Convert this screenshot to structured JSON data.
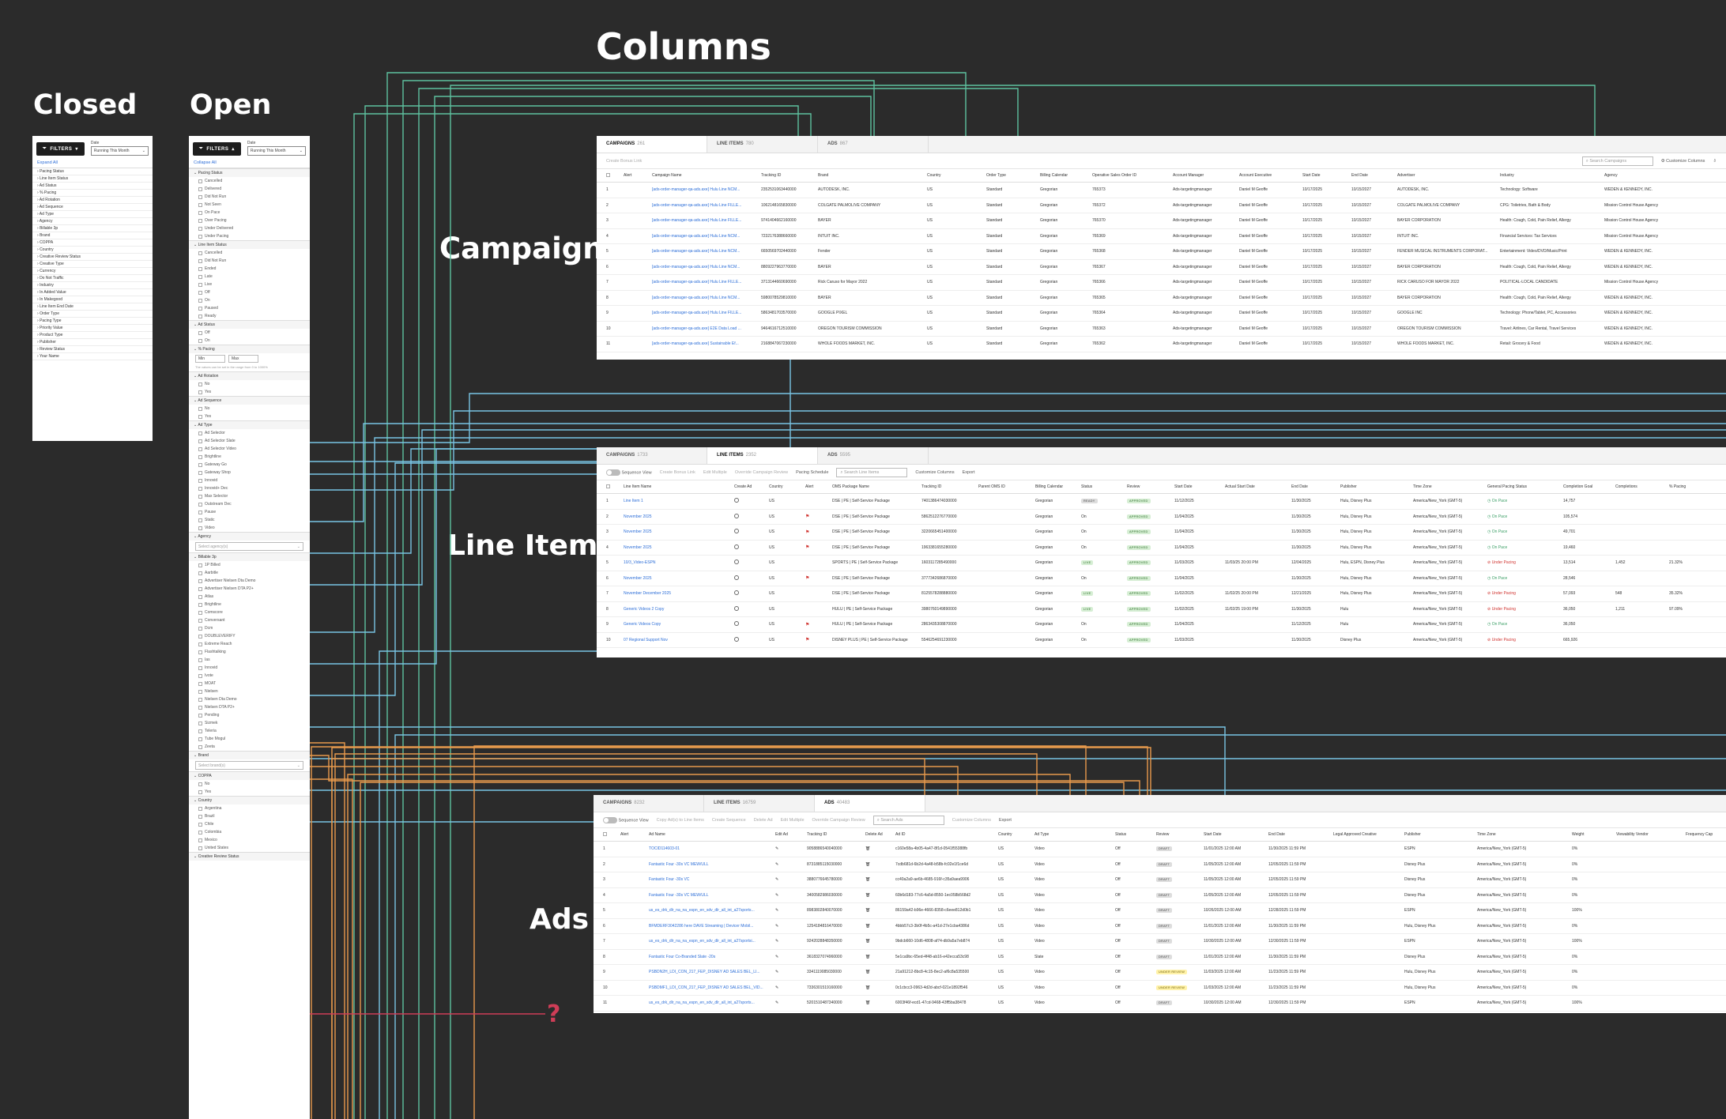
{
  "headings": {
    "columns": "Columns",
    "closed": "Closed",
    "open": "Open",
    "campaigns": "Campaigns",
    "line_items": "Line Items",
    "ads": "Ads"
  },
  "question_mark": "?",
  "colors": {
    "background": "#2b2b2b",
    "wire_green": "#5ec2a0",
    "wire_blue": "#79c4e4",
    "wire_orange": "#e89a4c",
    "wire_red": "#cf3d57",
    "link": "#2e6fd8"
  },
  "closed_panel": {
    "filters_label": "FILTERS",
    "date_label": "Date",
    "date_value": "Running This Month",
    "expand_all": "Expand All",
    "rows": [
      "Pacing Status",
      "Line Item Status",
      "Ad Status",
      "% Pacing",
      "Ad Rotation",
      "Ad Sequence",
      "Ad Type",
      "Agency",
      "Billable 3p",
      "Brand",
      "COPPA",
      "Country",
      "Creative Review Status",
      "Creative Type",
      "Currency",
      "Do Not Traffic",
      "Industry",
      "In Added Value",
      "In Makegood",
      "Line Item End Date",
      "Order Type",
      "Pacing Type",
      "Priority Value",
      "Product Type",
      "Publisher",
      "Review Status",
      "Your Name"
    ]
  },
  "open_panel": {
    "filters_label": "FILTERS",
    "date_label": "Date",
    "date_value": "Running This Month",
    "collapse_all": "Collapse All",
    "sections": [
      {
        "title": "Pacing Status",
        "options": [
          "Cancelled",
          "Delivered",
          "Did Not Run",
          "Not Seen",
          "On Pace",
          "Over Pacing",
          "Under Delivered",
          "Under Pacing"
        ]
      },
      {
        "title": "Line Item Status",
        "options": [
          "Cancelled",
          "Did Not Run",
          "Ended",
          "Late",
          "Live",
          "Off",
          "On",
          "Paused",
          "Ready"
        ]
      },
      {
        "title": "Ad Status",
        "options": [
          "Off",
          "On"
        ]
      },
      {
        "title": "% Pacing",
        "min_label": "Min",
        "max_label": "Max",
        "note": "The values can be set in the range from 0 to 1000%"
      },
      {
        "title": "Ad Rotation",
        "options": [
          "No",
          "Yes"
        ]
      },
      {
        "title": "Ad Sequence",
        "options": [
          "No",
          "Yes"
        ]
      },
      {
        "title": "Ad Type",
        "options": [
          "Ad Selector",
          "Ad Selector Slate",
          "Ad Selector Video",
          "Brightline",
          "Gateway Go",
          "Gateway Shop",
          "Innovid",
          "Innovid+ Dec",
          "Max Selector",
          "Outstream Dec",
          "Pause",
          "Static",
          "Video"
        ]
      },
      {
        "title": "Agency",
        "placeholder": "Select agency(s)"
      },
      {
        "title": "Billable 3p",
        "options": [
          "1P Billed",
          "Aarbitle",
          "Advertiser Nielsen Dta Demo",
          "Advertiser Nielsen DTA P2+",
          "Atlas",
          "Brightline",
          "Comscore",
          "Conversant",
          "Dcm",
          "DOUBLEVERIFY",
          "Extreme Reach",
          "Flashtalking",
          "Ias",
          "Innovid",
          "Ivote",
          "MOAT",
          "Nielsen",
          "Nielsen Dta Demo",
          "Nielsen DTA P2+",
          "Pending",
          "Sizmek",
          "Teleria",
          "Tube Mogul",
          "Zeeta"
        ]
      },
      {
        "title": "Brand",
        "placeholder": "Select brand(s)"
      },
      {
        "title": "COPPA",
        "options": [
          "No",
          "Yes"
        ]
      },
      {
        "title": "Country",
        "options": [
          "Argentina",
          "Brazil",
          "Chile",
          "Colombia",
          "Mexico",
          "United States"
        ]
      },
      {
        "title": "Creative Review Status",
        "options": []
      }
    ]
  },
  "campaigns_table": {
    "tabs": [
      {
        "label": "CAMPAIGNS",
        "count": "261"
      },
      {
        "label": "LINE ITEMS",
        "count": "780"
      },
      {
        "label": "ADS",
        "count": "867"
      }
    ],
    "toolbar": {
      "create": "Create Bonus Link",
      "search": "Search Campaigns",
      "customize": "Customize Columns"
    },
    "columns": [
      "Alert",
      "Campaign Name",
      "Tracking ID",
      "Brand",
      "Country",
      "Order Type",
      "Billing Calendar",
      "Operative Sales Order ID",
      "Account Manager",
      "Account Executive",
      "Start Date",
      "End Date",
      "Advertiser",
      "Industry",
      "Agency"
    ],
    "rows": [
      [
        "1",
        "[ads-order-manager-qa-ads.axe] Hulu Line NCM...",
        "2352531063440000",
        "AUTODESK, INC.",
        "US",
        "Standard",
        "Gregorian",
        "765373",
        "Ads-targetingmanager",
        "Daniel M Geoffe",
        "10/17/2025",
        "10/15/2027",
        "AUTODESK, INC.",
        "Technology: Software",
        "WEDEN & KENNEDY, INC."
      ],
      [
        "2",
        "[ads-order-manager-qa-ads.axe] Hulu Line FILLE...",
        "1062148165830000",
        "COLGATE PALMOLIVE COMPANY",
        "US",
        "Standard",
        "Gregorian",
        "765372",
        "Ads-targetingmanager",
        "Daniel M Geoffe",
        "10/17/2025",
        "10/15/2027",
        "COLGATE PALMOLIVE COMPANY",
        "CPG: Toiletries, Bath & Body",
        "Mission Control House Agency"
      ],
      [
        "3",
        "[ads-order-manager-qa-ads.axe] Hulu Line FILLE...",
        "9741404662160000",
        "BAYER",
        "US",
        "Standard",
        "Gregorian",
        "765370",
        "Ads-targetingmanager",
        "Daniel M Geoffe",
        "10/17/2025",
        "10/15/2027",
        "BAYER CORPORATION",
        "Health: Cough, Cold, Pain Relief, Allergy",
        "Mission Control House Agency"
      ],
      [
        "4",
        "[ads-order-manager-qa-ads.axe] Hulu Line NCM...",
        "7232176388660000",
        "INTUIT INC.",
        "US",
        "Standard",
        "Gregorian",
        "765369",
        "Ads-targetingmanager",
        "Daniel M Geoffe",
        "10/17/2025",
        "10/15/2027",
        "INTUIT INC.",
        "Financial Services: Tax Services",
        "Mission Control House Agency"
      ],
      [
        "5",
        "[ads-order-manager-qa-ads.axe] Hulu Line NCM...",
        "6650569702440000",
        "Fender",
        "US",
        "Standard",
        "Gregorian",
        "765368",
        "Ads-targetingmanager",
        "Daniel M Geoffe",
        "10/17/2025",
        "10/15/2027",
        "FENDER MUSICAL INSTRUMENTS CORPORAT...",
        "Entertainment: Video/DVD/Music/Print",
        "WEDEN & KENNEDY, INC."
      ],
      [
        "6",
        "[ads-order-manager-qa-ads.axe] Hulu Line NCM...",
        "8809227963770000",
        "BAYER",
        "US",
        "Standard",
        "Gregorian",
        "765367",
        "Ads-targetingmanager",
        "Daniel M Geoffe",
        "10/17/2025",
        "10/15/2027",
        "BAYER CORPORATION",
        "Health: Cough, Cold, Pain Relief, Allergy",
        "WEDEN & KENNEDY, INC."
      ],
      [
        "7",
        "[ads-order-manager-qa-ads.axe] Hulu Line FILLE...",
        "3713144660690000",
        "Rick Caruso for Mayor 2022",
        "US",
        "Standard",
        "Gregorian",
        "765366",
        "Ads-targetingmanager",
        "Daniel M Geoffe",
        "10/17/2025",
        "10/15/2027",
        "RICK CARUSO FOR MAYOR 2022",
        "POLITICAL-LOCAL CANDIDATE",
        "Mission Control House Agency"
      ],
      [
        "8",
        "[ads-order-manager-qa-ads.axe] Hulu Line NCM...",
        "5980078529810000",
        "BAYER",
        "US",
        "Standard",
        "Gregorian",
        "765365",
        "Ads-targetingmanager",
        "Daniel M Geoffe",
        "10/17/2025",
        "10/15/2027",
        "BAYER CORPORATION",
        "Health: Cough, Cold, Pain Relief, Allergy",
        "WEDEN & KENNEDY, INC."
      ],
      [
        "9",
        "[ads-order-manager-qa-ads.axe] Hulu Line FILLE...",
        "5863481703570000",
        "GOOGLE PIXEL",
        "US",
        "Standard",
        "Gregorian",
        "765364",
        "Ads-targetingmanager",
        "Daniel M Geoffe",
        "10/17/2025",
        "10/15/2027",
        "GOOGLE INC",
        "Technology: Phone/Tablet, PC, Accessories",
        "WEDEN & KENNEDY, INC."
      ],
      [
        "10",
        "[ads-order-manager-qa-ads.axe] E2E Data Load ...",
        "9464616712510000",
        "OREGON TOURISM COMMISSION",
        "US",
        "Standard",
        "Gregorian",
        "765363",
        "Ads-targetingmanager",
        "Daniel M Geoffe",
        "10/17/2025",
        "10/15/2027",
        "OREGON TOURISM COMMISSION",
        "Travel: Airlines, Car Rental, Travel Services",
        "WEDEN & KENNEDY, INC."
      ],
      [
        "11",
        "[ads-order-manager-qa-ads.axe] Sustainable Ef...",
        "2168847067230000",
        "WHOLE FOODS MARKET, INC.",
        "US",
        "Standard",
        "Gregorian",
        "765362",
        "Ads-targetingmanager",
        "Daniel M Geoffe",
        "10/17/2025",
        "10/15/2027",
        "WHOLE FOODS MARKET, INC.",
        "Retail: Grocery & Food",
        "WEDEN & KENNEDY, INC."
      ]
    ]
  },
  "lineitems_table": {
    "tabs": [
      {
        "label": "CAMPAIGNS",
        "count": "1733"
      },
      {
        "label": "LINE ITEMS",
        "count": "2352"
      },
      {
        "label": "ADS",
        "count": "5595"
      }
    ],
    "toolbar": {
      "sequence": "Sequence View",
      "create": "Create Bonus Link",
      "edit": "Edit Multiple",
      "override": "Override Campaign Review",
      "schedule": "Pacing Schedule",
      "search": "Search Line Items",
      "customize": "Customize Columns",
      "export": "Export"
    },
    "columns": [
      "Line Item Name",
      "Create Ad",
      "Country",
      "Alert",
      "OMS Package Name",
      "Tracking ID",
      "Parent OMS ID",
      "Billing Calendar",
      "Status",
      "Review",
      "Start Date",
      "Actual Start Date",
      "End Date",
      "Publisher",
      "Time Zone",
      "General Pacing Status",
      "Completion Goal",
      "Completions",
      "% Pacing"
    ],
    "rows": [
      [
        "1",
        "Line Item 1",
        "US",
        "",
        "DSE | PE | Self-Service Package",
        "7401386474030000",
        "",
        "Gregorian",
        "READY",
        "APPROVED",
        "11/12/2025",
        "",
        "11/30/2025",
        "Hulu, Disney Plus",
        "America/New_York (GMT-5)",
        "On Pace",
        "14,757",
        "",
        ""
      ],
      [
        "2",
        "November 2025",
        "US",
        "flag",
        "DSE | PE | Self-Service Package",
        "5862512276770000",
        "",
        "Gregorian",
        "On",
        "APPROVED",
        "11/04/2025",
        "",
        "11/30/2025",
        "Hulu, Disney Plus",
        "America/New_York (GMT-5)",
        "On Pace",
        "105,574",
        "",
        ""
      ],
      [
        "3",
        "November 2025",
        "US",
        "flag",
        "DSE | PE | Self-Service Package",
        "3220665451400000",
        "",
        "Gregorian",
        "On",
        "APPROVED",
        "11/04/2025",
        "",
        "11/30/2025",
        "Hulu, Disney Plus",
        "America/New_York (GMT-5)",
        "On Pace",
        "49,701",
        "",
        ""
      ],
      [
        "4",
        "November 2025",
        "US",
        "flag",
        "DSE | PE | Self-Service Package",
        "1963381655280000",
        "",
        "Gregorian",
        "On",
        "APPROVED",
        "11/04/2025",
        "",
        "11/30/2025",
        "Hulu, Disney Plus",
        "America/New_York (GMT-5)",
        "On Pace",
        "19,460",
        "",
        ""
      ],
      [
        "5",
        "10/3_Video-ESPN",
        "US",
        "",
        "SPORTS | PE | Self-Service Package",
        "1603117285490000",
        "",
        "Gregorian",
        "LIVE",
        "APPROVED",
        "11/03/2025",
        "11/03/25 20:00 PM",
        "12/04/2025",
        "Hulu, ESPN, Disney Plus",
        "America/New_York (GMT-5)",
        "Under Pacing",
        "13,514",
        "1,452",
        "21.32%"
      ],
      [
        "6",
        "November 2025",
        "US",
        "flag",
        "DSE | PE | Self-Service Package",
        "3777342686870000",
        "",
        "Gregorian",
        "On",
        "APPROVED",
        "11/04/2025",
        "",
        "11/30/2025",
        "Hulu, Disney Plus",
        "America/New_York (GMT-5)",
        "On Pace",
        "28,546",
        "",
        ""
      ],
      [
        "7",
        "November December 2025",
        "US",
        "",
        "DSE | PE | Self-Service Package",
        "8125578288880000",
        "",
        "Gregorian",
        "LIVE",
        "APPROVED",
        "11/02/2025",
        "11/02/25 20:00 PM",
        "12/21/2025",
        "Hulu, Disney Plus",
        "America/New_York (GMT-5)",
        "Under Pacing",
        "57,093",
        "548",
        "35.32%"
      ],
      [
        "8",
        "Generic Videos 2 Copy",
        "US",
        "",
        "HULU | PE | Self-Service Package",
        "3980760149890000",
        "",
        "Gregorian",
        "LIVE",
        "APPROVED",
        "11/02/2025",
        "11/02/25 19:00 PM",
        "11/30/2025",
        "Hulu",
        "America/New_York (GMT-5)",
        "Under Pacing",
        "36,050",
        "1,211",
        "97.09%"
      ],
      [
        "9",
        "Generic Videos Copy",
        "US",
        "flag",
        "HULU | PE | Self-Service Package",
        "2863435308870000",
        "",
        "Gregorian",
        "On",
        "APPROVED",
        "11/04/2025",
        "",
        "11/12/2025",
        "Hulu",
        "America/New_York (GMT-5)",
        "On Pace",
        "36,050",
        "",
        ""
      ],
      [
        "10",
        "07 Regional Support Nov",
        "US",
        "flag",
        "DISNEY PLUS | PE | Self-Service Package",
        "5546254691230000",
        "",
        "Gregorian",
        "On",
        "APPROVED",
        "11/03/2025",
        "",
        "11/30/2025",
        "Disney Plus",
        "America/New_York (GMT-5)",
        "Under Pacing",
        "665,926",
        "",
        ""
      ]
    ]
  },
  "ads_table": {
    "tabs": [
      {
        "label": "CAMPAIGNS",
        "count": "8232"
      },
      {
        "label": "LINE ITEMS",
        "count": "16759"
      },
      {
        "label": "ADS",
        "count": "40483"
      }
    ],
    "toolbar": {
      "sequence": "Sequence View",
      "copy": "Copy Ad(s) to Line Items",
      "create_seq": "Create Sequence",
      "delete": "Delete Ad",
      "edit": "Edit Multiple",
      "override": "Override Campaign Review",
      "search": "Search Ads",
      "customize": "Customize Columns",
      "export": "Export"
    },
    "columns": [
      "Alert",
      "Ad Name",
      "Edit Ad",
      "Tracking ID",
      "Delete Ad",
      "Ad ID",
      "Country",
      "Ad Type",
      "Status",
      "Review",
      "Start Date",
      "End Date",
      "Legal Approved Creative",
      "Publisher",
      "Time Zone",
      "Weight",
      "Viewability Vendor",
      "Frequency Cap"
    ],
    "rows": [
      [
        "1",
        "TOCID114603-01",
        "9058886540040000",
        "c160e58a-4b05-4a47-8f1d-0541f55388fb",
        "US",
        "Video",
        "Off",
        "DRAFT",
        "11/01/2025 12:00 AM",
        "11/30/2025 11:59 PM",
        "",
        "ESPN",
        "America/New_York (GMT-5)",
        "0%"
      ],
      [
        "2",
        "Fantastic Four -30s VC MEW/ULL",
        "8731885115030000",
        "7cdb681d-6b2d-4a48-b58b-fc02e1f1ce6d",
        "US",
        "Video",
        "Off",
        "DRAFT",
        "11/05/2025 12:00 AM",
        "12/05/2025 11:59 PM",
        "",
        "Disney Plus",
        "America/New_York (GMT-5)",
        "0%"
      ],
      [
        "3",
        "Fantastic Four -30s VC",
        "3880776645780000",
        "cc40a2a9-ae6b-4685-916f-c35a9aea9906",
        "US",
        "Video",
        "Off",
        "DRAFT",
        "11/05/2025 12:00 AM",
        "12/05/2025 11:59 PM",
        "",
        "Disney Plus",
        "America/New_York (GMT-5)",
        "0%"
      ],
      [
        "4",
        "Fantastic Four -30s VC MEW/ULL",
        "3400582986030000",
        "60b6d183-77c6-4a5d-8550-1ec058b568d2",
        "US",
        "Video",
        "Off",
        "DRAFT",
        "11/05/2025 12:00 AM",
        "12/05/2025 11:59 PM",
        "",
        "Disney Plus",
        "America/New_York (GMT-5)",
        "0%"
      ],
      [
        "5",
        "us_es_drk_dlr_na_na_espn_en_sdv_dlr_all_int_a27sports...",
        "8983802840070000",
        "86159a42-b96e-4666-8358-c6eee812d0b1",
        "US",
        "Video",
        "Off",
        "DRAFT",
        "10/26/2025 12:00 AM",
        "12/28/2025 11:59 PM",
        "",
        "ESPN",
        "America/New_York (GMT-5)",
        "100%"
      ],
      [
        "6",
        "BFMDERF3042286 here DAVE Streaming | Devicer Mobil...",
        "1254184816470000",
        "4bbb57c3-3b0f-4b5c-a41d-27e1cba4386d",
        "US",
        "Video",
        "Off",
        "DRAFT",
        "11/01/2025 12:00 AM",
        "11/30/2025 11:59 PM",
        "",
        "Hulu, Disney Plus",
        "America/New_York (GMT-5)",
        "0%"
      ],
      [
        "7",
        "us_es_drk_dlr_na_na_espn_en_sdv_dlr_all_int_a27sportsi...",
        "9242028848350000",
        "9bdcb660-10d6-4808-af74-db9a5a7eb874",
        "US",
        "Video",
        "Off",
        "DRAFT",
        "10/30/2025 12:00 AM",
        "12/30/2025 11:59 PM",
        "",
        "ESPN",
        "America/New_York (GMT-5)",
        "100%"
      ],
      [
        "8",
        "Fantastic Four Co-Branded Slate -20s",
        "3618327074960000",
        "5e1ca9bc-65ed-4f48-ab16-e42ecca53c98",
        "US",
        "Slate",
        "Off",
        "DRAFT",
        "11/01/2025 12:00 AM",
        "11/30/2025 11:59 PM",
        "",
        "Disney Plus",
        "America/New_York (GMT-5)",
        "0%"
      ],
      [
        "9",
        "PSBDN2H_LDI_CON_217_FEP_DISNEY AD SALES BEL_LI...",
        "3341119085030000",
        "21a91212-8bc8-4c15-8ec2-af6c8a535500",
        "US",
        "Video",
        "Off",
        "UNDER REVIEW",
        "11/03/2025 12:00 AM",
        "11/23/2025 11:59 PM",
        "",
        "Hulu, Disney Plus",
        "America/New_York (GMT-5)",
        "0%"
      ],
      [
        "10",
        "PSBDMF1_LDI_CON_217_FEP_DISNEY AD SALES BEL_VID...",
        "7336301519160000",
        "0c1cbcc3-0963-4d2d-abcf-021e1892f546",
        "US",
        "Video",
        "Off",
        "UNDER REVIEW",
        "11/03/2025 12:00 AM",
        "11/23/2025 11:59 PM",
        "",
        "Hulu, Disney Plus",
        "America/New_York (GMT-5)",
        "0%"
      ],
      [
        "11",
        "us_es_drk_dlr_na_na_espn_en_sdv_dlr_all_int_a27sports...",
        "5201510487340000",
        "6003f46f-ecd1-47cd-9468-43ff5ba38478",
        "US",
        "Video",
        "Off",
        "DRAFT",
        "10/30/2025 12:00 AM",
        "12/30/2025 11:59 PM",
        "",
        "ESPN",
        "America/New_York (GMT-5)",
        "100%"
      ]
    ]
  }
}
